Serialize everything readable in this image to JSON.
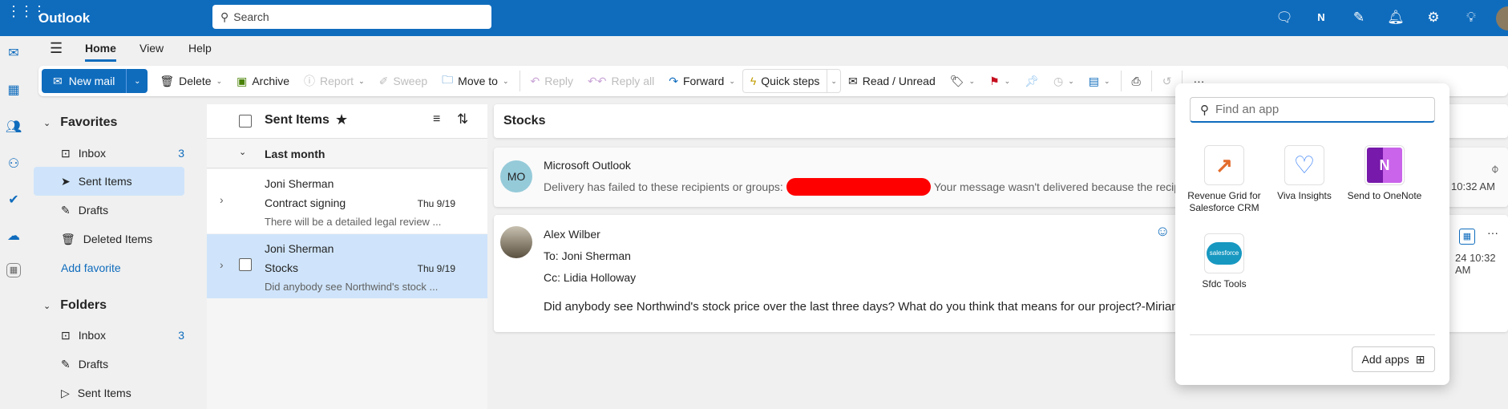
{
  "app": {
    "title": "Outlook",
    "search_placeholder": "Search"
  },
  "header_icons": [
    "chat-icon",
    "onenote-icon",
    "tasks-icon",
    "bell-icon",
    "gear-icon",
    "lightbulb-icon"
  ],
  "tabs": [
    "Home",
    "View",
    "Help"
  ],
  "ribbon": {
    "new_mail": "New mail",
    "delete": "Delete",
    "archive": "Archive",
    "report": "Report",
    "sweep": "Sweep",
    "move_to": "Move to",
    "reply": "Reply",
    "reply_all": "Reply all",
    "forward": "Forward",
    "quick_steps": "Quick steps",
    "read_unread": "Read / Unread",
    "more": "···"
  },
  "folders": {
    "favorites_label": "Favorites",
    "favorites": [
      {
        "label": "Inbox",
        "count": "3"
      },
      {
        "label": "Sent Items",
        "count": ""
      },
      {
        "label": "Drafts",
        "count": ""
      },
      {
        "label": "Deleted Items",
        "count": ""
      }
    ],
    "add_favorite": "Add favorite",
    "folders_label": "Folders",
    "folders": [
      {
        "label": "Inbox",
        "count": "3"
      },
      {
        "label": "Drafts",
        "count": ""
      },
      {
        "label": "Sent Items",
        "count": ""
      }
    ]
  },
  "list": {
    "title": "Sent Items",
    "group": "Last month",
    "messages": [
      {
        "from": "Joni Sherman",
        "subject": "Contract signing",
        "date": "Thu 9/19",
        "preview": "There will be a detailed legal review ..."
      },
      {
        "from": "Joni Sherman",
        "subject": "Stocks",
        "date": "Thu 9/19",
        "preview": "Did anybody see Northwind's stock ..."
      }
    ]
  },
  "reading": {
    "subject": "Stocks",
    "ndr": {
      "initials": "MO",
      "from": "Microsoft Outlook",
      "text_before": "Delivery has failed to these recipients or groups:",
      "text_after": "Your message wasn't delivered because the recipie",
      "time": "10:32 AM"
    },
    "mail": {
      "from": "Alex Wilber",
      "to_label": "To:",
      "to": "Joni Sherman",
      "cc_label": "Cc:",
      "cc": "Lidia Holloway",
      "body": "Did anybody see Northwind's stock price over the last three days? What do you think that means for our project?-Miriam",
      "time": "24 10:32 AM"
    }
  },
  "popup": {
    "search_placeholder": "Find an app",
    "apps": [
      {
        "name": "Revenue Grid for Salesforce CRM"
      },
      {
        "name": "Viva Insights"
      },
      {
        "name": "Send to OneNote"
      },
      {
        "name": "Sfdc Tools"
      }
    ],
    "add_apps": "Add apps"
  },
  "colors": {
    "brand": "#0f6cbd",
    "selected": "#cfe4fa",
    "redaction": "#ff0000"
  }
}
